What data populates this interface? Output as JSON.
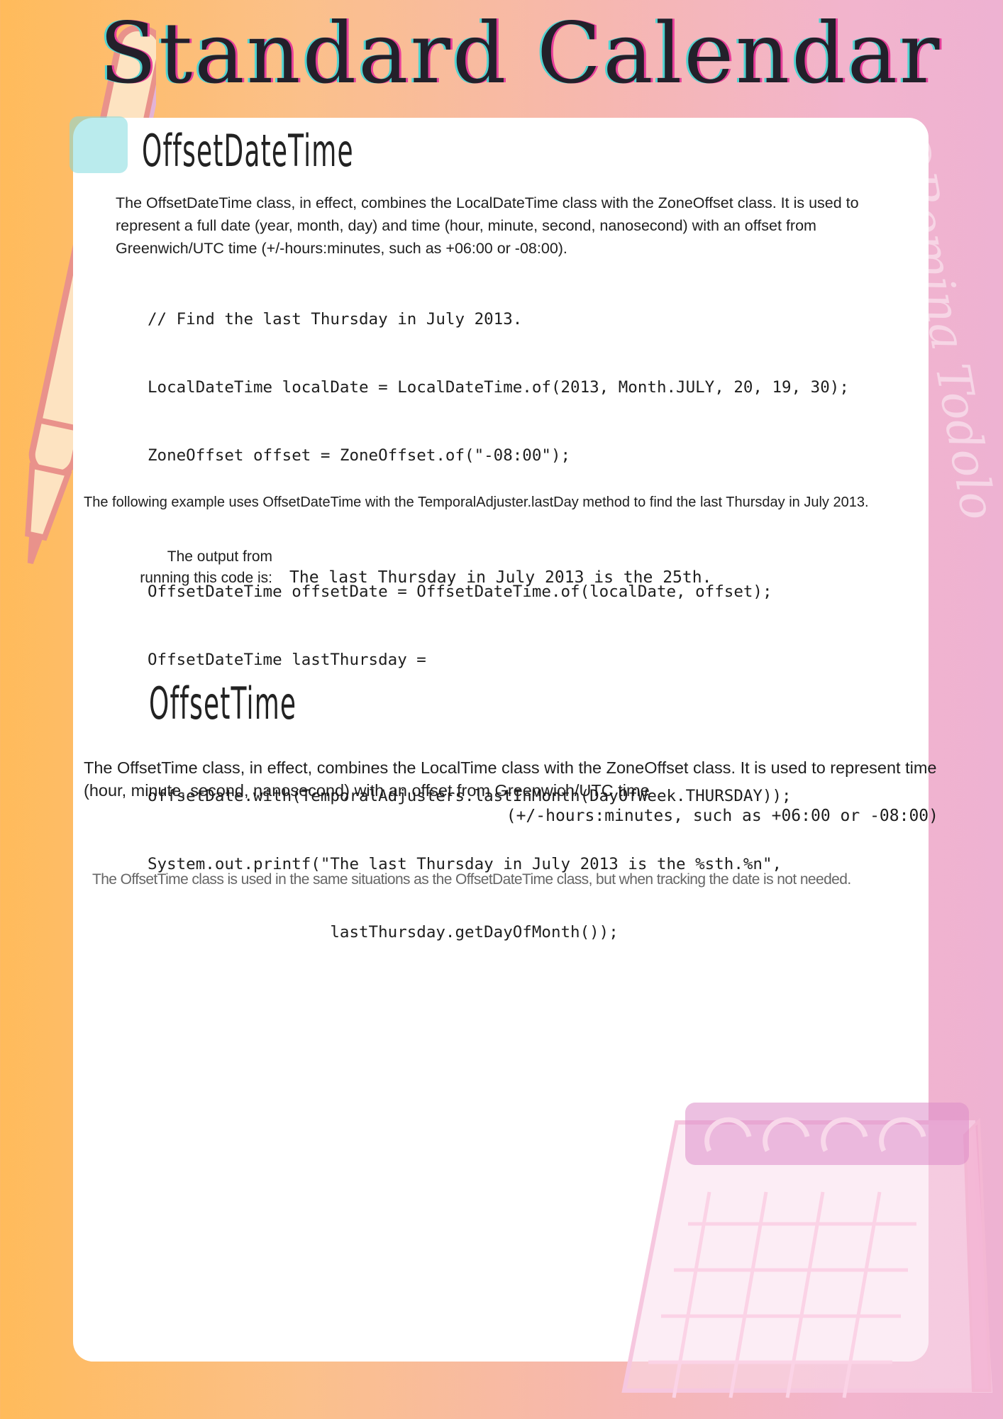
{
  "header": {
    "title": "Standard Calendar"
  },
  "watermark": {
    "text": "@Romina Todolo"
  },
  "sections": {
    "offset_date_time": {
      "heading": "OffsetDateTime",
      "intro": "The OffsetDateTime class, in effect, combines the LocalDateTime class with the ZoneOffset class. It is used to represent a full date (year, month, day) and time (hour, minute, second, nanosecond) with an offset from Greenwich/UTC time (+/-hours:minutes, such as +06:00 or -08:00).",
      "code": [
        "// Find the last Thursday in July 2013.",
        "LocalDateTime localDate = LocalDateTime.of(2013, Month.JULY, 20, 19, 30);",
        "ZoneOffset offset = ZoneOffset.of(\"-08:00\");",
        "",
        "OffsetDateTime offsetDate = OffsetDateTime.of(localDate, offset);",
        "OffsetDateTime lastThursday =",
        "",
        "offsetDate.with(TemporalAdjusters.lastInMonth(DayOfWeek.THURSDAY));",
        "System.out.printf(\"The last Thursday in July 2013 is the %sth.%n\",",
        "                   lastThursday.getDayOfMonth());"
      ],
      "example_note": "The following example uses OffsetDateTime with the TemporalAdjuster.lastDay method to find the last Thursday in July 2013.",
      "output_label": "The output from running this code is:",
      "output_value": "The last Thursday in July 2013 is the 25th."
    },
    "offset_time": {
      "heading": "OffsetTime",
      "intro": "The OffsetTime class, in effect, combines the LocalTime class with the ZoneOffset class. It is used to represent time (hour, minute, second, nanosecond) with an offset from Greenwich/UTC time",
      "intro_mono": "(+/-hours:minutes, such as +06:00 or -08:00)",
      "note": "The OffsetTime class is used in the same situations as the OffsetDateTime class, but when tracking the date is not needed."
    }
  },
  "decorations": {
    "pen_icon": "pen-icon",
    "calendar_icon": "calendar-icon",
    "accent_teal": "#4fd3d1",
    "accent_magenta": "#e63e9a",
    "gradient_left": "#ffbb5b",
    "gradient_right": "#eeb2d2"
  }
}
